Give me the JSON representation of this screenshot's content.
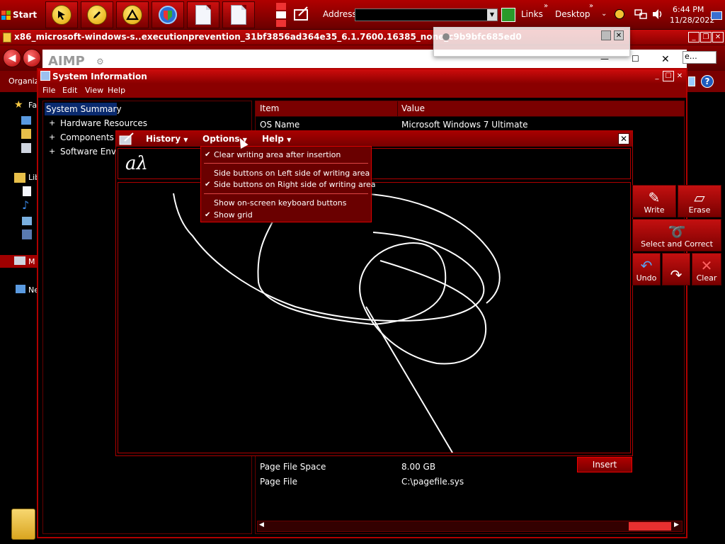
{
  "taskbar": {
    "start_label": "Start",
    "address_label": "Address",
    "links_label": "Links",
    "desktop_label": "Desktop",
    "time": "6:44 PM",
    "date": "11/28/2022"
  },
  "explorer": {
    "title": "x86_microsoft-windows-s..executionprevention_31bf3856ad364e35_6.1.7600.16385_none_c9b9bfc685ed0",
    "organize_label": "Organiz",
    "aimp_logo": "AIMP",
    "nav_items": [
      "Fa",
      "Lib",
      "M",
      "Ne"
    ],
    "help_icon": "?"
  },
  "sysinfo": {
    "title": "System Information",
    "menu": [
      "File",
      "Edit",
      "View",
      "Help"
    ],
    "tree": [
      {
        "label": "System Summary",
        "expander": ""
      },
      {
        "label": "Hardware Resources",
        "expander": "+"
      },
      {
        "label": "Components",
        "expander": "+"
      },
      {
        "label": "Software Envi",
        "expander": "+"
      }
    ],
    "columns": [
      "Item",
      "Value"
    ],
    "rows_top": [
      {
        "item": "OS Name",
        "value": "Microsoft Windows 7 Ultimate"
      }
    ],
    "rows_bottom": [
      {
        "item": "Page File Space",
        "value": "8.00 GB"
      },
      {
        "item": "Page File",
        "value": "C:\\pagefile.sys"
      }
    ]
  },
  "tip": {
    "menu": [
      "History",
      "Options",
      "Help"
    ],
    "preview_text": "aλ",
    "side_buttons": {
      "write": "Write",
      "erase": "Erase",
      "select_correct": "Select and Correct",
      "undo": "Undo",
      "redo": "",
      "clear": "Clear"
    },
    "insert_label": "Insert",
    "options_menu": [
      {
        "label": "Clear writing area after insertion",
        "checked": true
      },
      {
        "label": "Side buttons on Left side of writing area",
        "checked": false
      },
      {
        "label": "Side buttons on Right side of writing area",
        "checked": true
      },
      {
        "label": "Show on-screen keyboard buttons",
        "checked": false
      },
      {
        "label": "Show grid",
        "checked": true
      }
    ],
    "check_glyph": "✔"
  },
  "colors": {
    "accent": "#b00000",
    "dark": "#6a0000",
    "text": "#ffffff"
  }
}
